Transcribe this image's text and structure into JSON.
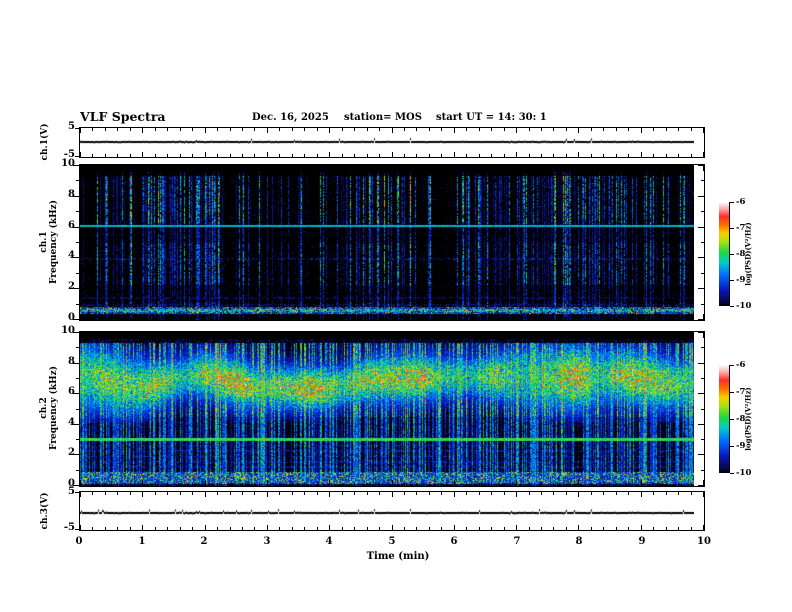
{
  "header": {
    "title": "VLF Spectra",
    "date": "Dec. 16, 2025",
    "station": "station= MOS",
    "start_ut": "start UT =  14: 30: 1"
  },
  "panels": {
    "ch1_voltage": {
      "label": "ch.1(V)",
      "ymin": -5,
      "ymax": 5,
      "ytick_labels": [
        "5",
        "-5"
      ],
      "signal_level_v": 0.5
    },
    "ch1_spectrogram": {
      "label_line1": "ch.1",
      "label_line2": "Frequency (kHz)",
      "ymin": 0,
      "ymax": 10,
      "ytick_labels": [
        "10",
        "8",
        "6",
        "4",
        "2",
        "0"
      ]
    },
    "ch2_spectrogram": {
      "label_line1": "ch.2",
      "label_line2": "Frequency (kHz)",
      "ymin": 0,
      "ymax": 10,
      "ytick_labels": [
        "10",
        "8",
        "6",
        "4",
        "2",
        "0"
      ]
    },
    "ch3_voltage": {
      "label": "ch.3(V)",
      "ymin": -5,
      "ymax": 5,
      "ytick_labels": [
        "5",
        "-5"
      ],
      "signal_level_v": -0.4
    }
  },
  "time_axis": {
    "label": "Time (min)",
    "min": 0,
    "max": 10,
    "major_tick_labels": [
      "0",
      "1",
      "2",
      "3",
      "4",
      "5",
      "6",
      "7",
      "8",
      "9",
      "10"
    ],
    "minor_ticks_per_major": 5,
    "data_end_min": 9.8
  },
  "colorbar": {
    "label": "log(PSD)(V²/Hz)",
    "tick_labels": [
      "-6",
      "-7",
      "-8",
      "-9",
      "-10"
    ],
    "gradient_top_to_bottom": [
      "#ffffff",
      "#ffa5a5",
      "#ff2d28",
      "#ff6e00",
      "#facd00",
      "#a5e114",
      "#28d73c",
      "#00cdc3",
      "#006eff",
      "#0a19be",
      "#080846",
      "#000008"
    ]
  },
  "chart_data": [
    {
      "panel": "ch.1(V)",
      "type": "line",
      "ylabel": "ch.1(V)",
      "ylim": [
        -5,
        5
      ],
      "xlim": [
        0,
        10
      ],
      "x_unit": "min",
      "data_extent_min": [
        0,
        9.8
      ],
      "summary": "flat voltage trace at approximately +0.5 V for the whole record"
    },
    {
      "panel": "ch.1 spectrogram",
      "type": "heatmap",
      "ylabel": "Frequency (kHz)",
      "ylim": [
        0,
        10
      ],
      "xlim": [
        0,
        10
      ],
      "zlabel": "log(PSD)(V²/Hz)",
      "zlim": [
        -10,
        -6
      ],
      "summary": "sparse vertical sferic streaks (dark blue/cyan, occasional green) from ~0.3 to ~9.3 kHz on black background; continuous narrowband cyan line at ~6.1 kHz; strong dashed emission band 0.4-0.9 kHz; no data above ~9.3 kHz; record ends at 9.8 min"
    },
    {
      "panel": "ch.2 spectrogram",
      "type": "heatmap",
      "ylabel": "Frequency (kHz)",
      "ylim": [
        0,
        10
      ],
      "xlim": [
        0,
        10
      ],
      "zlabel": "log(PSD)(V²/Hz)",
      "zlim": [
        -10,
        -6
      ],
      "summary": "dense vertical streaks; bright green/yellow (locally orange-red) emission band ~4.5-9 kHz peaking near 7 kHz; narrowband green line at ~3.0 kHz; faint dotted harmonic rows 0.9-2.7 kHz; strong dashed band 0.2-0.9 kHz; black above ~9.3 kHz; record ends at 9.8 min"
    },
    {
      "panel": "ch.3(V)",
      "type": "line",
      "ylabel": "ch.3(V)",
      "ylim": [
        -5,
        5
      ],
      "xlim": [
        0,
        10
      ],
      "x_unit": "min",
      "data_extent_min": [
        0,
        9.8
      ],
      "summary": "flat voltage trace at approximately -0.4 V with tiny upward blips"
    }
  ],
  "spectrogram_render": {
    "ch1": {
      "seed": 1234,
      "streak_density": 0.62,
      "green_streak_prob": 0.1,
      "max_freq_khz": 9.3,
      "solid_lines_khz": [
        6.1
      ],
      "dashed_lines_khz": [
        3.95,
        1.45,
        1.0
      ],
      "bottom_band_khz": [
        0.42,
        0.88
      ]
    },
    "ch2": {
      "seed": 98765,
      "streak_density": 0.8,
      "band_center_khz": 6.8,
      "band_sigma_khz": 1.2,
      "max_freq_khz": 9.35,
      "solid_lines_khz": [
        3.05
      ],
      "dashed_lines_khz": [
        0.9,
        1.25,
        1.6,
        1.95,
        2.3,
        2.65
      ],
      "bottom_band_khz": [
        0.18,
        0.95
      ]
    }
  }
}
